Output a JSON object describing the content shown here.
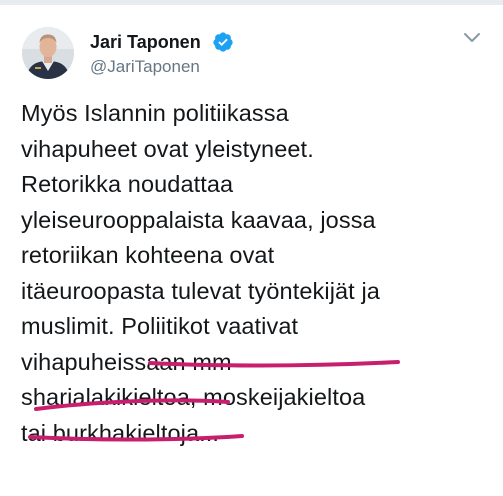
{
  "tweet": {
    "author": {
      "display_name": "Jari Taponen",
      "handle": "@JariTaponen",
      "verified_icon": "verified-badge-icon",
      "avatar_icon": "avatar-photo"
    },
    "menu_icon": "chevron-down-icon",
    "text_lines": [
      "Myös Islannin politiikassa",
      "vihapuheet ovat yleistyneet.",
      "Retorikka noudattaa",
      "yleiseurooppalaista kaavaa, jossa",
      "retoriikan kohteena ovat",
      "itäeuroopasta tulevat työntekijät ja",
      "muslimit. Poliitikot vaativat",
      "vihapuheissaan mm",
      "sharialakikieltoa, moskeijakieltoa",
      "tai burkhakieltoja..."
    ],
    "colors": {
      "verified_blue": "#1da1f2",
      "handle_gray": "#657786",
      "highlight_marker": "#c81e6e"
    }
  }
}
